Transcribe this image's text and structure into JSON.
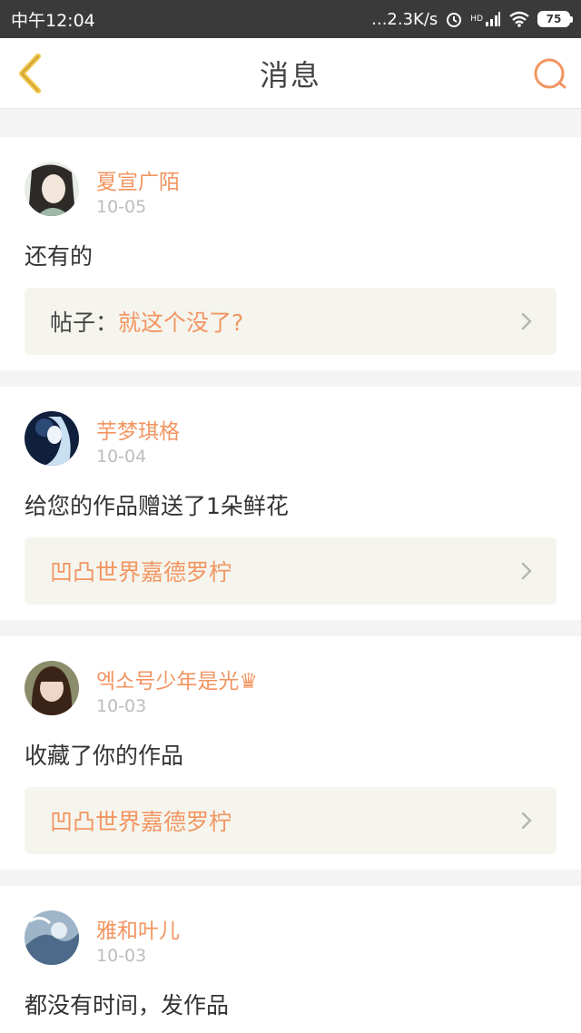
{
  "status_bar": {
    "time": "中午12:04",
    "speed": "...2.3K/s",
    "network": "HD",
    "battery": "75"
  },
  "header": {
    "title": "消息"
  },
  "messages": [
    {
      "name": "夏宣广陌",
      "date": "10-05",
      "text": "还有的",
      "ref_prefix": "帖子：",
      "ref_text": "就这个没了?"
    },
    {
      "name": "芋梦琪格",
      "date": "10-04",
      "text": "给您的作品赠送了1朵鲜花",
      "ref_prefix": "",
      "ref_text": "凹凸世界嘉德罗柠"
    },
    {
      "name": "엑소号少年是光♛",
      "date": "10-03",
      "text": "收藏了你的作品",
      "ref_prefix": "",
      "ref_text": "凹凸世界嘉德罗柠"
    },
    {
      "name": "雅和叶儿",
      "date": "10-03",
      "text": "都没有时间，发作品"
    }
  ],
  "colors": {
    "accent": "#f29561",
    "back_arrow": "#f3c54a",
    "status_bar": "#3a3a3a"
  }
}
